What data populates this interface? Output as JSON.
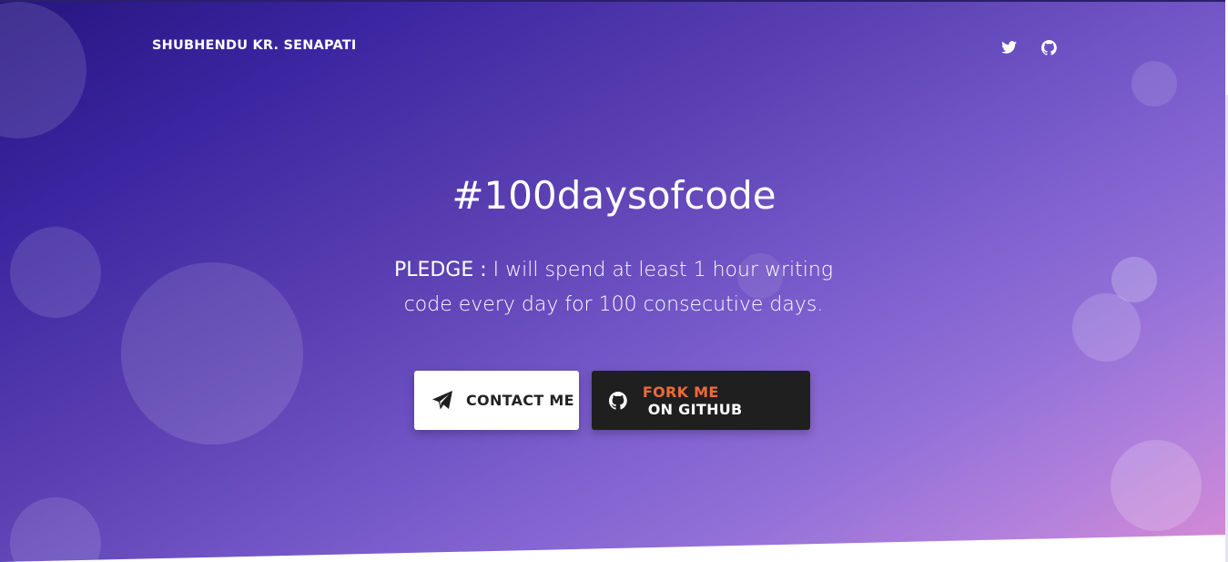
{
  "header": {
    "brand": "SHUBHENDU KR. SENAPATI",
    "social_icons": [
      "twitter-icon",
      "github-icon"
    ]
  },
  "hero": {
    "title": "#100daysofcode",
    "pledge_label": "PLEDGE :",
    "pledge_line1": " I will spend at least 1 hour writing",
    "pledge_line2": "code every day for 100 consecutive days."
  },
  "buttons": {
    "contact": {
      "label": "CONTACT ME",
      "icon": "paper-plane-icon"
    },
    "fork": {
      "label_accent": "FORK ME",
      "label_rest": " ON GITHUB",
      "icon": "github-icon"
    }
  },
  "colors": {
    "gradient_start": "#271580",
    "gradient_end": "#d98bd4",
    "fork_accent": "#ef6a36",
    "fork_button_bg": "#1f1f1f",
    "contact_button_bg": "#ffffff"
  }
}
